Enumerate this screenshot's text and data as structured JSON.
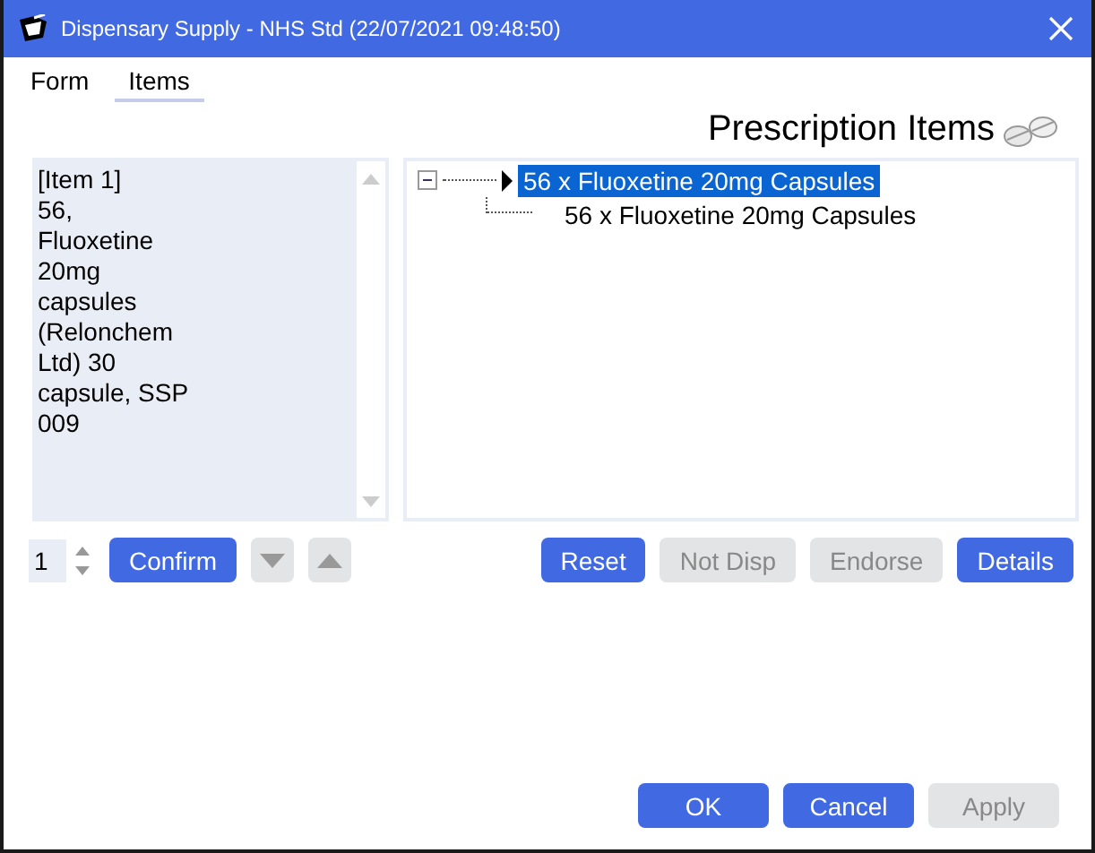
{
  "window": {
    "title": "Dispensary Supply - NHS Std (22/07/2021 09:48:50)"
  },
  "tabs": [
    {
      "label": "Form",
      "selected": false
    },
    {
      "label": "Items",
      "selected": true
    }
  ],
  "heading": "Prescription Items",
  "item_text": "[Item 1]\n56,\nFluoxetine\n20mg\ncapsules\n(Relonchem\nLtd) 30\ncapsule, SSP\n009",
  "tree": [
    {
      "label": "56 x Fluoxetine 20mg Capsules",
      "expanded": true,
      "selected": true,
      "children": [
        {
          "label": "56 x Fluoxetine 20mg Capsules",
          "selected": false
        }
      ]
    }
  ],
  "quantity": "1",
  "confirm_button": {
    "label": "Confirm",
    "disabled": false
  },
  "item_buttons": [
    {
      "label": "Reset",
      "disabled": false
    },
    {
      "label": "Not Disp",
      "disabled": true
    },
    {
      "label": "Endorse",
      "disabled": true
    },
    {
      "label": "Details",
      "disabled": false
    }
  ],
  "dialog_buttons": [
    {
      "label": "OK",
      "disabled": false
    },
    {
      "label": "Cancel",
      "disabled": false
    },
    {
      "label": "Apply",
      "disabled": true
    }
  ]
}
